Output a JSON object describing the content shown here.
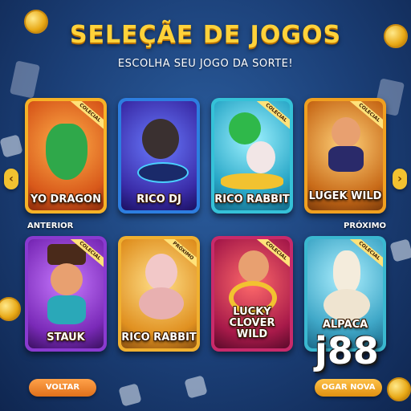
{
  "header": {
    "title": "SELEÇÃE DE JOGOS",
    "subtitle": "ESCOLHA SEU JOGO DA SORTE!"
  },
  "nav": {
    "prev_label": "ANTERIOR",
    "next_label": "PRÓXIMO"
  },
  "games": [
    {
      "name": "YO DRAGON",
      "ribbon": "COLECIAL"
    },
    {
      "name": "RICO DJ",
      "ribbon": ""
    },
    {
      "name": "RICO RABBIT",
      "ribbon": "COLECIAL"
    },
    {
      "name": "LUGEK WILD",
      "ribbon": "COLECIAL"
    },
    {
      "name": "STAUK",
      "ribbon": "COLECIAL"
    },
    {
      "name": "RICO RABBIT",
      "ribbon": "PRÓXIMO"
    },
    {
      "name": "LUCKY CLOVER WILD",
      "ribbon": "COLECIAL"
    },
    {
      "name": "ALPACA",
      "ribbon": "COLECIAL"
    }
  ],
  "footer": {
    "back_label": "VOLTAR",
    "play_label": "OGAR NOVA",
    "brand": "j88"
  },
  "colors": {
    "title": "#ffd23a",
    "back_button": "#f08a2a",
    "play_button": "#f0a020"
  }
}
